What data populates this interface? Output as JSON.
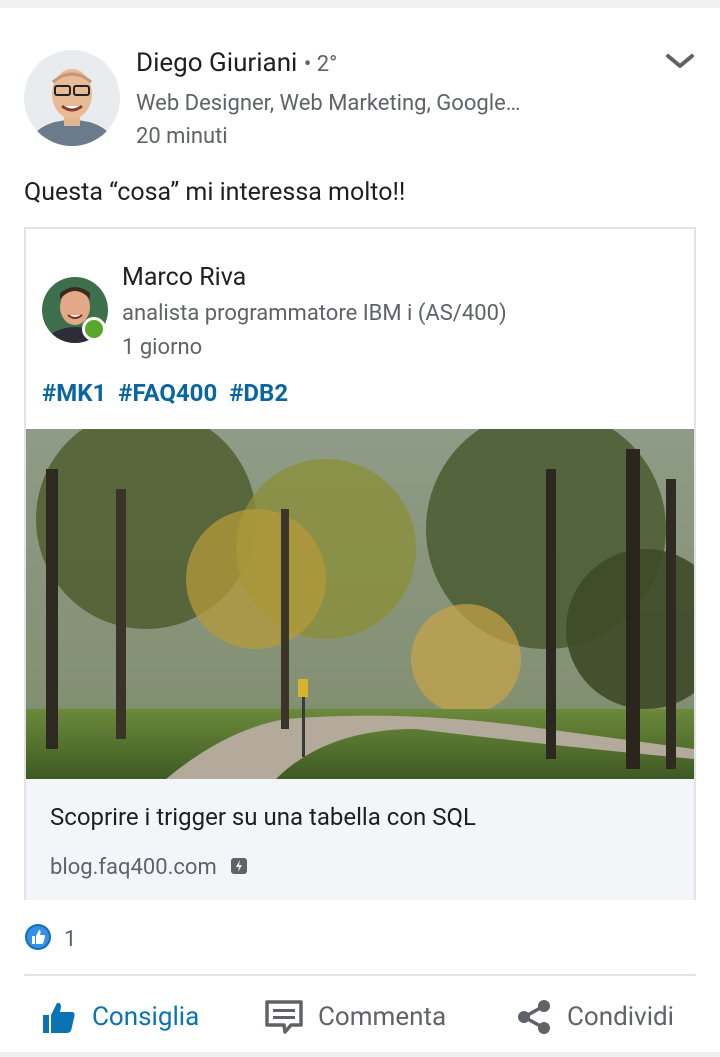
{
  "author": {
    "name": "Diego Giuriani",
    "degree": "• 2°",
    "headline": "Web Designer, Web Marketing, Google…",
    "time": "20 minuti"
  },
  "post_text": "Questa “cosa” mi interessa molto!!",
  "shared": {
    "name": "Marco Riva",
    "headline": "analista programmatore IBM i (AS/400)",
    "time": "1 giorno",
    "hashtags": [
      "#MK1",
      "#FAQ400",
      "#DB2"
    ],
    "link_title": "Scoprire i trigger su una tabella con SQL",
    "link_domain": "blog.faq400.com"
  },
  "reactions": {
    "count": "1"
  },
  "actions": {
    "like": "Consiglia",
    "comment": "Commenta",
    "share": "Condividi"
  },
  "colors": {
    "link_blue": "#0a66a0",
    "online_green": "#59a62a"
  },
  "icons": [
    "chevron-down-icon",
    "like-icon",
    "comment-icon",
    "share-icon",
    "amp-icon"
  ]
}
